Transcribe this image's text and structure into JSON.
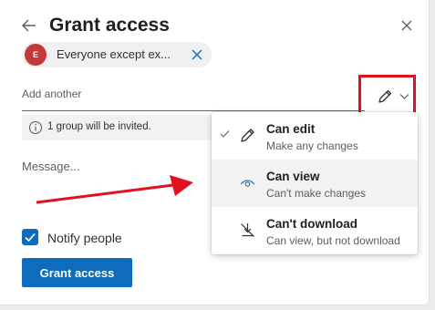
{
  "dialog": {
    "title": "Grant access"
  },
  "recipient": {
    "avatar_initial": "E",
    "avatar_color": "#c43a3a",
    "label": "Everyone except ex..."
  },
  "add_another": {
    "label": "Add another"
  },
  "info": {
    "text": "1 group will be invited."
  },
  "message": {
    "placeholder": "Message..."
  },
  "notify": {
    "label": "Notify people",
    "checked": true
  },
  "grant_button": {
    "label": "Grant access"
  },
  "permissions_menu": {
    "items": [
      {
        "title": "Can edit",
        "subtitle": "Make any changes",
        "icon": "pencil-icon",
        "checked": true
      },
      {
        "title": "Can view",
        "subtitle": "Can't make changes",
        "icon": "eye-icon",
        "checked": false,
        "highlighted": true
      },
      {
        "title": "Can't download",
        "subtitle": "Can view, but not download",
        "icon": "no-download-icon",
        "checked": false
      }
    ]
  },
  "colors": {
    "accent": "#0f6cbd",
    "highlight_box": "#e0121d",
    "annotation_arrow": "#e0121d"
  }
}
